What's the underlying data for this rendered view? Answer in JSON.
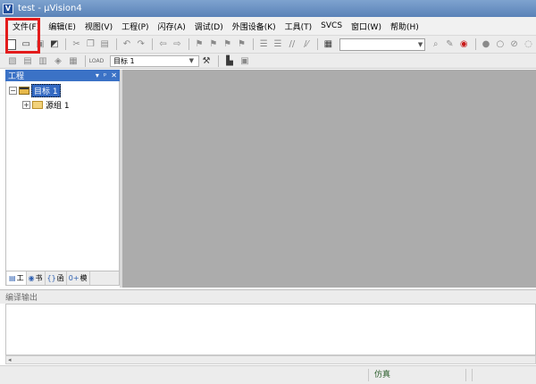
{
  "window": {
    "title": "test - µVision4",
    "icon_text": "V"
  },
  "menu": {
    "items": [
      "文件(F)",
      "编辑(E)",
      "视图(V)",
      "工程(P)",
      "闪存(A)",
      "调试(D)",
      "外围设备(K)",
      "工具(T)",
      "SVCS",
      "窗口(W)",
      "帮助(H)"
    ]
  },
  "toolbar": {
    "load_label": "LOAD",
    "target_combo_value": "目标 1"
  },
  "project_panel": {
    "title": "工程",
    "pin_glyph": "▾",
    "pin2_glyph": "ᵖ",
    "close_glyph": "✕",
    "tree": {
      "target": "目标 1",
      "group": "源组 1",
      "expand_glyph": "−",
      "collapse_glyph": "+"
    },
    "tabs": [
      {
        "label": "工",
        "icon": "project-icon"
      },
      {
        "label": "书",
        "icon": "books-icon"
      },
      {
        "label": "函",
        "icon": "functions-icon"
      },
      {
        "label": "模",
        "icon": "templates-icon"
      }
    ],
    "tab_icon_glyphs": [
      "▤",
      "◉",
      "{}",
      "0+"
    ]
  },
  "output_panel": {
    "title": "编译输出"
  },
  "status": {
    "mode": "仿真"
  },
  "colors": {
    "highlight": "#e31b1b",
    "selection": "#3369c2",
    "editor_bg": "#acacac"
  }
}
